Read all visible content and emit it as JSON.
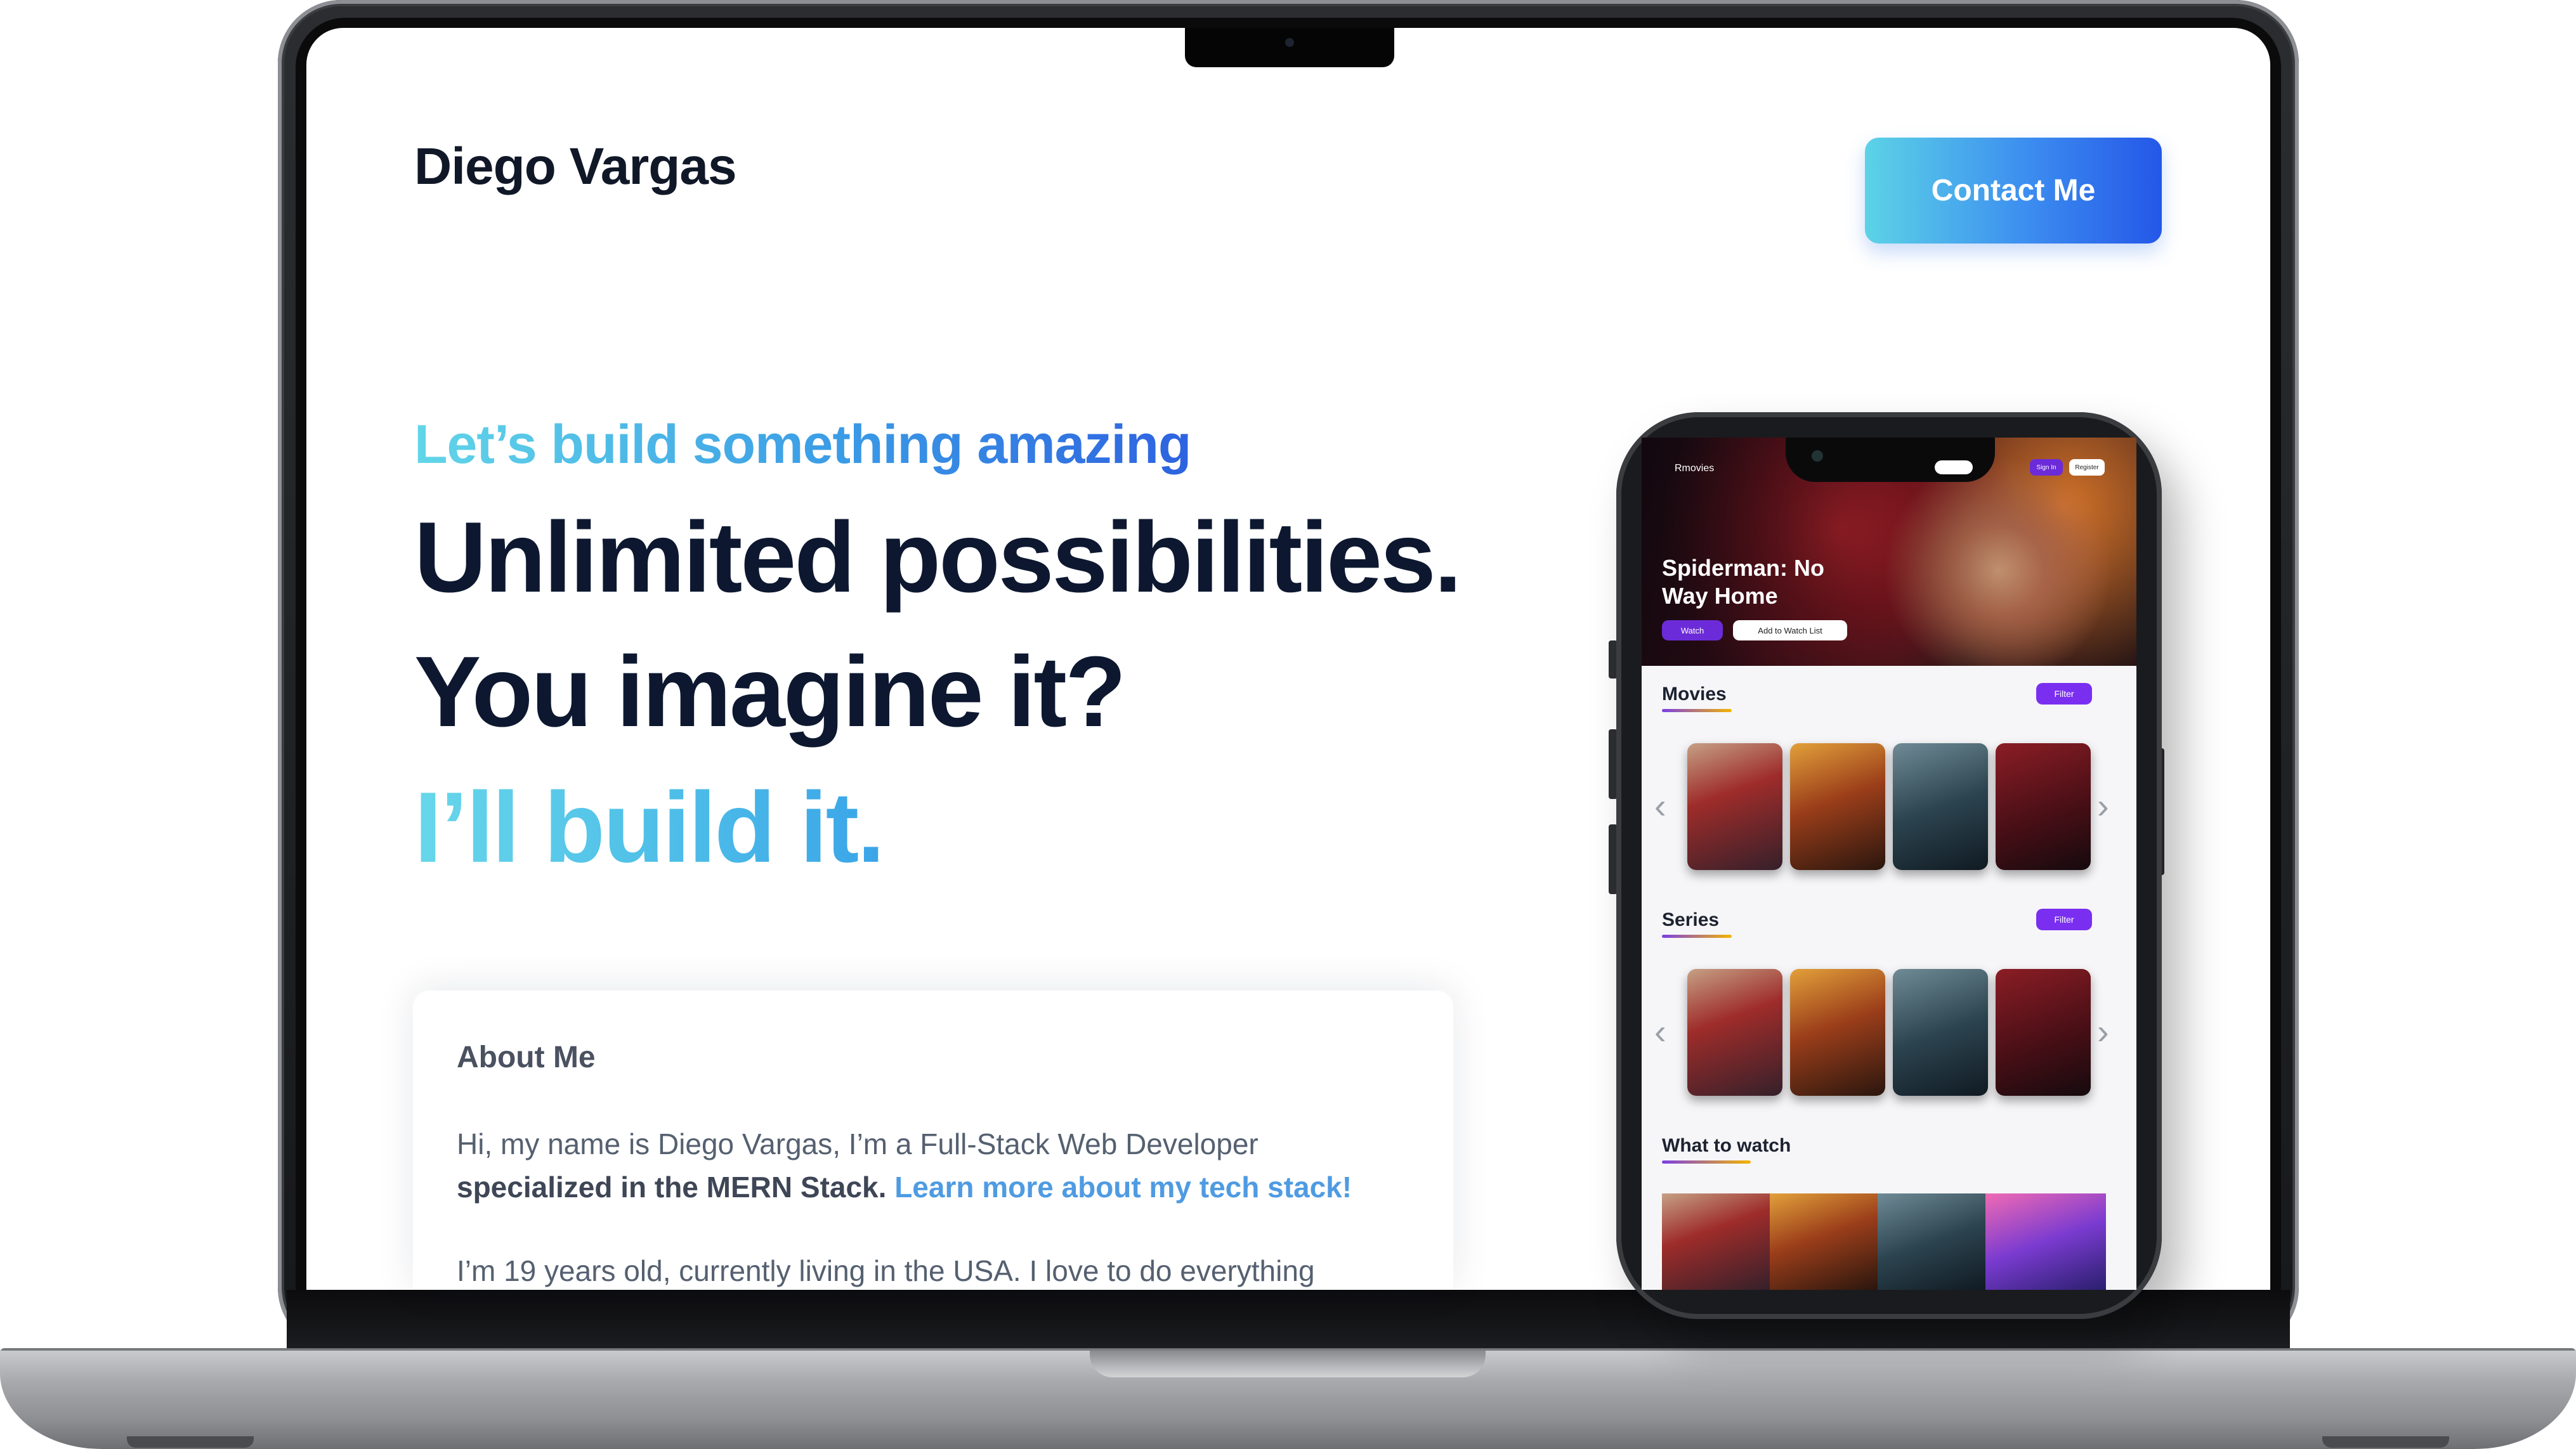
{
  "site": {
    "brand": "Diego Vargas",
    "contact_label": "Contact Me",
    "tagline": "Let’s build something amazing",
    "hero_line1": "Unlimited possibilities.",
    "hero_line2": "You imagine it?",
    "hero_line3": "I’ll build it.",
    "about": {
      "title": "About Me",
      "p1_intro": "Hi, my name is Diego Vargas, I’m a Full-Stack Web Developer",
      "p1_bold": "specialized in the MERN Stack.",
      "p1_link": "Learn more about my  tech stack!",
      "p2": "I’m 19 years old, currently living in the USA.  I love to do everything"
    }
  },
  "phone_app": {
    "logo": "Rmovies",
    "signin_label": "Sign In",
    "register_label": "Register",
    "banner_title": "Spiderman: No Way Home",
    "watch_label": "Watch",
    "watchlist_label": "Add to Watch List",
    "sections": {
      "movies": "Movies",
      "series": "Series",
      "what_to_watch": "What to watch"
    },
    "filter_label": "Filter"
  },
  "colors": {
    "brand_gradient_start": "#5cd3e6",
    "brand_gradient_end": "#2457e8",
    "hero_text": "#0d1830",
    "app_accent": "#7a2ff0"
  }
}
